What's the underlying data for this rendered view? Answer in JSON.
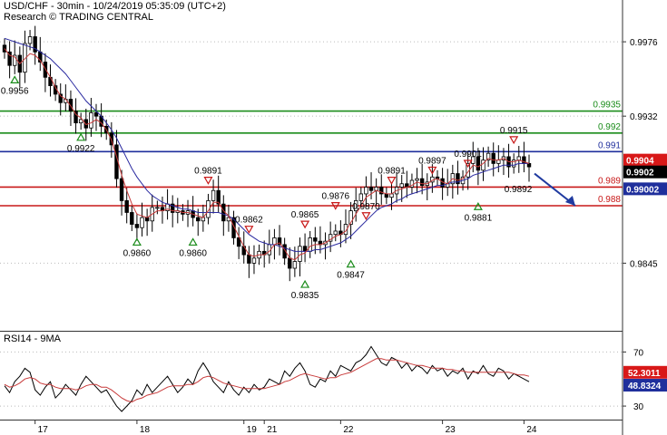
{
  "header": {
    "line1": "USD/CHF - 30min - 10/24/2019 05:35:09 (UTC+2)",
    "line2": "Research © TRADING CENTRAL"
  },
  "rsi_panel": {
    "label": "RSI14 - 9MA"
  },
  "colors": {
    "green_level": "#1a8c1a",
    "blue_level": "#1f2f9c",
    "red_level": "#c81818",
    "ma_red": "#c83a3a",
    "ma_blue": "#2a2aa0",
    "candle": "#000000",
    "down_marker": "#c81818",
    "up_marker": "#1a8c1a",
    "arrow": "#1f3aa0"
  },
  "chart_data": {
    "type": "candlestick",
    "symbol": "USD/CHF",
    "timeframe": "30min",
    "price_axis": {
      "ylim": [
        0.9805,
        0.999
      ],
      "ticks": [
        "0.9976",
        "0.9932",
        "0.9845"
      ],
      "tick_values": [
        0.9976,
        0.9932,
        0.9845
      ]
    },
    "x_ticks": [
      "17",
      "18",
      "19",
      "21",
      "22",
      "23",
      "24"
    ],
    "x_tick_index": [
      6,
      26,
      47,
      51,
      66,
      86,
      102
    ],
    "levels": [
      {
        "label": "0.9935",
        "value": 0.9935,
        "color": "green"
      },
      {
        "label": "0.992",
        "value": 0.9922,
        "color": "green"
      },
      {
        "label": "0.991",
        "value": 0.9911,
        "color": "blue"
      },
      {
        "label": "0.989",
        "value": 0.989,
        "color": "red"
      },
      {
        "label": "0.988",
        "value": 0.9879,
        "color": "red"
      }
    ],
    "price_tags": [
      {
        "label": "0.9904",
        "value": 0.9906,
        "bg": "#d81818",
        "fg": "#ffffff"
      },
      {
        "label": "0.9902",
        "value": 0.9899,
        "bg": "#000000",
        "fg": "#ffffff"
      },
      {
        "label": "0.99002",
        "value": 0.9889,
        "bg": "#1f2f9c",
        "fg": "#ffffff"
      }
    ],
    "close": [
      0.997,
      0.9962,
      0.9968,
      0.9958,
      0.9975,
      0.9979,
      0.997,
      0.9964,
      0.9955,
      0.995,
      0.9945,
      0.994,
      0.9942,
      0.9935,
      0.9928,
      0.993,
      0.9925,
      0.9934,
      0.9932,
      0.9926,
      0.9922,
      0.9915,
      0.9895,
      0.9882,
      0.9875,
      0.9868,
      0.9866,
      0.9872,
      0.987,
      0.9878,
      0.9878,
      0.9876,
      0.988,
      0.9875,
      0.9876,
      0.9874,
      0.9876,
      0.9872,
      0.987,
      0.9872,
      0.9882,
      0.9888,
      0.988,
      0.987,
      0.9872,
      0.986,
      0.9855,
      0.985,
      0.9845,
      0.9848,
      0.9852,
      0.985,
      0.9856,
      0.986,
      0.9856,
      0.9848,
      0.9842,
      0.9846,
      0.9855,
      0.9852,
      0.986,
      0.9858,
      0.9856,
      0.9858,
      0.9862,
      0.9864,
      0.9862,
      0.9868,
      0.9876,
      0.9882,
      0.9886,
      0.989,
      0.9888,
      0.989,
      0.9886,
      0.9884,
      0.9886,
      0.989,
      0.9892,
      0.989,
      0.9894,
      0.9895,
      0.9891,
      0.9893,
      0.9896,
      0.9895,
      0.989,
      0.9892,
      0.9898,
      0.9892,
      0.9896,
      0.9904,
      0.9908,
      0.99,
      0.9906,
      0.991,
      0.9904,
      0.9906,
      0.9908,
      0.9902,
      0.9906,
      0.9908,
      0.9904,
      0.9902
    ],
    "ma_red": [
      0.9972,
      0.9968,
      0.9967,
      0.9963,
      0.9966,
      0.9969,
      0.9968,
      0.9965,
      0.996,
      0.9955,
      0.9949,
      0.9944,
      0.9942,
      0.9938,
      0.9933,
      0.9931,
      0.9927,
      0.9928,
      0.993,
      0.9928,
      0.9924,
      0.9918,
      0.9908,
      0.9897,
      0.9888,
      0.988,
      0.9874,
      0.9873,
      0.9872,
      0.9874,
      0.9876,
      0.9876,
      0.9877,
      0.9876,
      0.9876,
      0.9875,
      0.9875,
      0.9874,
      0.9873,
      0.9872,
      0.9876,
      0.9881,
      0.9881,
      0.9876,
      0.9873,
      0.9867,
      0.9861,
      0.9855,
      0.985,
      0.9849,
      0.985,
      0.985,
      0.9852,
      0.9856,
      0.9857,
      0.9853,
      0.9848,
      0.9847,
      0.985,
      0.9851,
      0.9855,
      0.9856,
      0.9856,
      0.9857,
      0.9859,
      0.9861,
      0.9862,
      0.9864,
      0.9869,
      0.9874,
      0.9879,
      0.9884,
      0.9886,
      0.9888,
      0.9887,
      0.9886,
      0.9886,
      0.9888,
      0.9889,
      0.989,
      0.9891,
      0.9893,
      0.9892,
      0.9892,
      0.9894,
      0.9895,
      0.9893,
      0.9892,
      0.9895,
      0.9894,
      0.9895,
      0.9899,
      0.9903,
      0.9902,
      0.9904,
      0.9907,
      0.9906,
      0.9906,
      0.9907,
      0.9905,
      0.9905,
      0.9906,
      0.9905,
      0.9904
    ],
    "ma_blue": [
      0.9978,
      0.9977,
      0.9976,
      0.9975,
      0.9974,
      0.9973,
      0.9972,
      0.997,
      0.9968,
      0.9966,
      0.9963,
      0.996,
      0.9957,
      0.9953,
      0.9949,
      0.9945,
      0.9941,
      0.9938,
      0.9935,
      0.9932,
      0.9928,
      0.9924,
      0.9919,
      0.9913,
      0.9907,
      0.9901,
      0.9896,
      0.9892,
      0.9888,
      0.9885,
      0.9883,
      0.9881,
      0.988,
      0.9879,
      0.9878,
      0.9877,
      0.9877,
      0.9876,
      0.9875,
      0.9875,
      0.9875,
      0.9875,
      0.9875,
      0.9874,
      0.9873,
      0.9871,
      0.9868,
      0.9865,
      0.9862,
      0.986,
      0.9858,
      0.9857,
      0.9856,
      0.9856,
      0.9855,
      0.9854,
      0.9853,
      0.9852,
      0.9852,
      0.9852,
      0.9852,
      0.9853,
      0.9853,
      0.9854,
      0.9855,
      0.9856,
      0.9857,
      0.9859,
      0.9861,
      0.9864,
      0.9867,
      0.987,
      0.9873,
      0.9876,
      0.9878,
      0.9879,
      0.988,
      0.9882,
      0.9883,
      0.9885,
      0.9886,
      0.9887,
      0.9888,
      0.9889,
      0.989,
      0.9891,
      0.9891,
      0.9892,
      0.9893,
      0.9893,
      0.9894,
      0.9895,
      0.9897,
      0.9898,
      0.9899,
      0.99,
      0.9901,
      0.9902,
      0.9903,
      0.9903,
      0.9903,
      0.9904,
      0.9904,
      0.9904
    ],
    "pivot_annotations": [
      {
        "label": "0.9956",
        "i": 2,
        "value": 0.9956,
        "marker": "up"
      },
      {
        "label": "0.9922",
        "i": 15,
        "value": 0.9922,
        "marker": "up"
      },
      {
        "label": "0.9860",
        "i": 26,
        "value": 0.986,
        "marker": "up"
      },
      {
        "label": "0.9860",
        "i": 37,
        "value": 0.986,
        "marker": "up"
      },
      {
        "label": "0.9891",
        "i": 40,
        "value": 0.9891,
        "marker": "down"
      },
      {
        "label": "0.9862",
        "i": 48,
        "value": 0.9862,
        "marker": "down"
      },
      {
        "label": "0.9865",
        "i": 59,
        "value": 0.9865,
        "marker": "down"
      },
      {
        "label": "0.9876",
        "i": 65,
        "value": 0.9876,
        "marker": "down"
      },
      {
        "label": "0.9870",
        "i": 71,
        "value": 0.987,
        "marker": "down"
      },
      {
        "label": "0.9835",
        "i": 59,
        "value": 0.9835,
        "marker": "up"
      },
      {
        "label": "0.9847",
        "i": 68,
        "value": 0.9847,
        "marker": "up"
      },
      {
        "label": "0.9891",
        "i": 76,
        "value": 0.9891,
        "marker": "down"
      },
      {
        "label": "0.9897",
        "i": 84,
        "value": 0.9897,
        "marker": "down"
      },
      {
        "label": "0.9901",
        "i": 91,
        "value": 0.9901,
        "marker": "down"
      },
      {
        "label": "0.9915",
        "i": 100,
        "value": 0.9915,
        "marker": "down"
      },
      {
        "label": "0.9881",
        "i": 93,
        "value": 0.9881,
        "marker": "up"
      },
      {
        "label": "0.9892",
        "i": 103,
        "value": 0.9892,
        "marker": "none"
      }
    ],
    "rsi": {
      "ylim": [
        20,
        85
      ],
      "ticks": [
        "70",
        "30"
      ],
      "tick_values": [
        70,
        30
      ],
      "tags": [
        {
          "label": "52.3011",
          "value": 52.3,
          "bg": "#d81818"
        },
        {
          "label": "48.8324",
          "value": 48.8,
          "bg": "#1f2f9c"
        }
      ],
      "rsi": [
        45,
        40,
        48,
        52,
        58,
        55,
        42,
        38,
        44,
        48,
        36,
        40,
        46,
        42,
        38,
        46,
        52,
        48,
        44,
        40,
        42,
        36,
        30,
        26,
        30,
        34,
        42,
        38,
        46,
        40,
        44,
        48,
        52,
        46,
        40,
        44,
        50,
        46,
        56,
        62,
        56,
        48,
        44,
        40,
        48,
        42,
        38,
        44,
        40,
        46,
        42,
        44,
        50,
        48,
        46,
        56,
        52,
        58,
        62,
        56,
        46,
        44,
        50,
        48,
        56,
        52,
        60,
        58,
        56,
        62,
        64,
        68,
        74,
        68,
        62,
        60,
        66,
        64,
        58,
        62,
        56,
        60,
        58,
        54,
        60,
        56,
        58,
        52,
        56,
        54,
        58,
        50,
        56,
        54,
        60,
        54,
        52,
        58,
        56,
        50,
        54,
        52,
        50,
        48
      ],
      "ma": [
        46,
        44,
        45,
        47,
        50,
        51,
        50,
        47,
        46,
        46,
        44,
        43,
        43,
        43,
        42,
        43,
        45,
        46,
        46,
        44,
        44,
        42,
        39,
        36,
        34,
        33,
        35,
        36,
        38,
        39,
        40,
        42,
        44,
        45,
        45,
        45,
        46,
        46,
        48,
        51,
        52,
        51,
        49,
        47,
        46,
        45,
        44,
        43,
        43,
        43,
        43,
        43,
        44,
        45,
        46,
        48,
        49,
        51,
        53,
        54,
        53,
        52,
        51,
        50,
        51,
        51,
        53,
        54,
        55,
        57,
        59,
        61,
        63,
        65,
        65,
        64,
        64,
        64,
        63,
        62,
        61,
        60,
        60,
        59,
        58,
        58,
        58,
        57,
        57,
        56,
        56,
        55,
        55,
        55,
        55,
        55,
        55,
        55,
        55,
        55,
        54,
        53,
        53,
        52
      ]
    },
    "forecast_arrow": {
      "from_i": 103,
      "from_value": 0.9898,
      "to_i": 111,
      "to_value": 0.9879
    }
  }
}
